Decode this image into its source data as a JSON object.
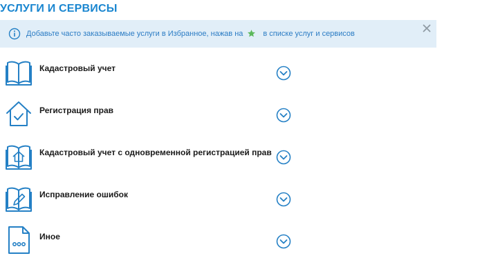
{
  "header": {
    "title": "УСЛУГИ И СЕРВИСЫ"
  },
  "info_banner": {
    "text_before": "Добавьте часто заказываемые услуги в Избранное, нажав на",
    "text_after": "в списке услуг и сервисов",
    "icon": "info-icon",
    "star_icon": "star-icon",
    "close_icon": "close-icon"
  },
  "services": [
    {
      "label": "Кадастровый учет",
      "icon": "book-icon"
    },
    {
      "label": "Регистрация прав",
      "icon": "house-check-icon"
    },
    {
      "label": "Кадастровый учет с одновременной регистрацией прав",
      "icon": "book-house-icon"
    },
    {
      "label": "Исправление ошибок",
      "icon": "book-pencil-icon"
    },
    {
      "label": "Иное",
      "icon": "document-dots-icon"
    }
  ],
  "colors": {
    "accent": "#1a86d0",
    "icon_blue": "#2480c5",
    "banner_bg": "#e1eef8",
    "star_green": "#5cb85c"
  }
}
